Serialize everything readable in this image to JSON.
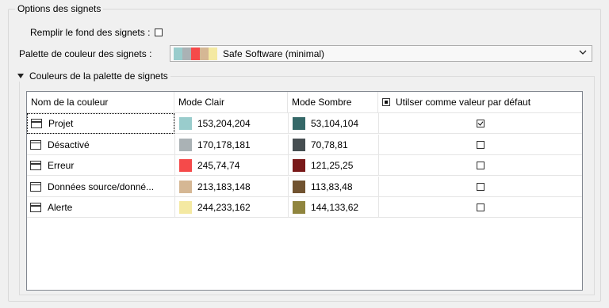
{
  "section": {
    "title": "Options des signets"
  },
  "fill_background": {
    "label": "Remplir le fond des signets :",
    "checked": false
  },
  "palette": {
    "label": "Palette de couleur des signets :",
    "selected": "Safe Software (minimal)",
    "swatches": [
      "#99cccc",
      "#aab2b5",
      "#f54a4a",
      "#d5b794",
      "#f4e9a2"
    ]
  },
  "palette_colors": {
    "title": "Couleurs de la palette de signets"
  },
  "table": {
    "columns": [
      "Nom de la couleur",
      "Mode Clair",
      "Mode Sombre",
      "Utilser comme valeur par défaut"
    ],
    "rows": [
      {
        "name": "Projet",
        "light": "153,204,204",
        "light_hex": "#99cccc",
        "dark": "53,104,104",
        "dark_hex": "#356868",
        "default": true
      },
      {
        "name": "Désactivé",
        "light": "170,178,181",
        "light_hex": "#aab2b5",
        "dark": "70,78,81",
        "dark_hex": "#464e51",
        "default": false
      },
      {
        "name": "Erreur",
        "light": "245,74,74",
        "light_hex": "#f54a4a",
        "dark": "121,25,25",
        "dark_hex": "#791919",
        "default": false
      },
      {
        "name": "Données source/donné...",
        "light": "213,183,148",
        "light_hex": "#d5b794",
        "dark": "113,83,48",
        "dark_hex": "#715330",
        "default": false
      },
      {
        "name": "Alerte",
        "light": "244,233,162",
        "light_hex": "#f4e9a2",
        "dark": "144,133,62",
        "dark_hex": "#90853e",
        "default": false
      }
    ]
  }
}
